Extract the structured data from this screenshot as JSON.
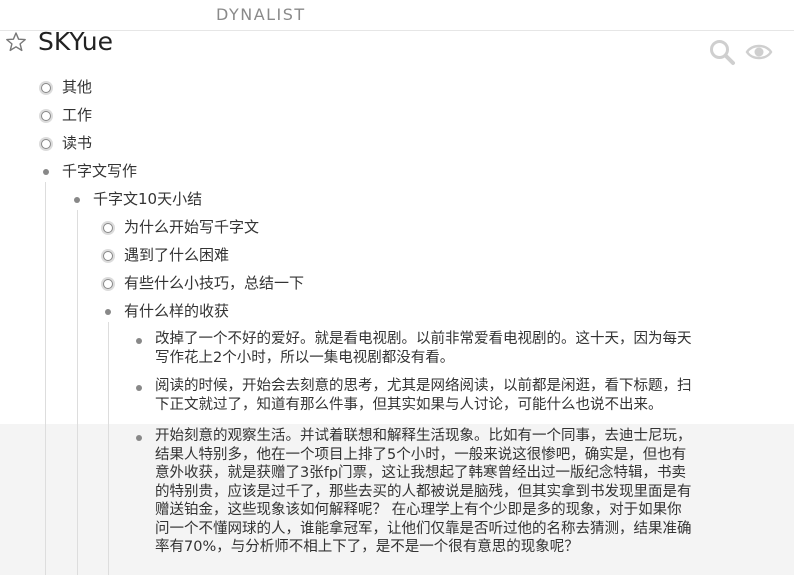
{
  "header": {
    "brand": "DYNALIST"
  },
  "document": {
    "title": "SKYue"
  },
  "toolbar": {
    "search_icon": "search-icon",
    "view_icon": "eye-icon",
    "star_icon": "star-icon"
  },
  "outline": {
    "items": [
      {
        "label": "其他",
        "state": "collapsed"
      },
      {
        "label": "工作",
        "state": "collapsed"
      },
      {
        "label": "读书",
        "state": "collapsed"
      },
      {
        "label": "千字文写作",
        "state": "expanded",
        "children": [
          {
            "label": "千字文10天小结",
            "state": "expanded",
            "children": [
              {
                "label": "为什么开始写千字文",
                "state": "collapsed"
              },
              {
                "label": "遇到了什么困难",
                "state": "collapsed"
              },
              {
                "label": "有些什么小技巧，总结一下",
                "state": "collapsed"
              },
              {
                "label": "有什么样的收获",
                "state": "expanded",
                "children": [
                  {
                    "lines": [
                      "改掉了一个不好的爱好。就是看电视剧。以前非常爱看电视剧的。这十天，因为每天",
                      "写作花上2个小时，所以一集电视剧都没有看。"
                    ]
                  },
                  {
                    "lines": [
                      "阅读的时候，开始会去刻意的思考，尤其是网络阅读，以前都是闲逛，看下标题，扫",
                      "下正文就过了，知道有那么件事，但其实如果与人讨论，可能什么也说不出来。"
                    ]
                  },
                  {
                    "lines": [
                      "开始刻意的观察生活。并试着联想和解释生活现象。比如有一个同事，去迪士尼玩，",
                      "结果人特别多，他在一个项目上排了5个小时，一般来说这很惨吧，确实是，但也有",
                      "意外收获，就是获赠了3张fp门票，这让我想起了韩寒曾经出过一版纪念特辑，书卖",
                      "的特别贵，应该是过千了，那些去买的人都被说是脑残，但其实拿到书发现里面是有",
                      "赠送铂金，这些现象该如何解释呢？  在心理学上有个少即是多的现象，对于如果你",
                      "问一个不懂网球的人，谁能拿冠军，让他们仅靠是否听过他的名称去猜测，结果准确",
                      "率有70%，与分析师不相上下了，是不是一个很有意思的现象呢？"
                    ]
                  }
                ]
              }
            ]
          }
        ]
      }
    ]
  }
}
